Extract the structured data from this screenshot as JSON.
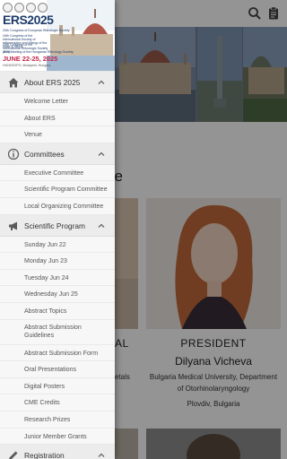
{
  "drawer": {
    "header": {
      "title": "ERS2025",
      "lines": [
        "20th Congress of European Rhinologic Society",
        "44th Congress of the International Society of Inflammation and Allergy of the Nose & ISIAN",
        "25th Congress of the International Rhinologic Society (IRS)",
        "Joint Meeting of the Hungarian Rhinology Society"
      ],
      "dates": "JUNE 22-25, 2025",
      "venue": "HUNGEXPO, Budapest, Hungary"
    },
    "sections": [
      {
        "label": "About ERS 2025",
        "icon": "home-icon",
        "expanded": true,
        "items": [
          "Welcome Letter",
          "About ERS",
          "Venue"
        ]
      },
      {
        "label": "Committees",
        "icon": "info-icon",
        "expanded": true,
        "items": [
          "Executive Committee",
          "Scientific Program Committee",
          "Local Organizing Committee"
        ]
      },
      {
        "label": "Scientific Program",
        "icon": "megaphone-icon",
        "expanded": true,
        "items": [
          "Sunday Jun 22",
          "Monday Jun 23",
          "Tuesday Jun 24",
          "Wednesday Jun 25",
          "Abstract Topics",
          "Abstract Submission Guidelines",
          "Abstract Submission Form",
          "Oral Presentations",
          "Digital Posters",
          "CME Credits",
          "Research Prizes",
          "Junior Member Grants"
        ]
      },
      {
        "label": "Registration",
        "icon": "pencil-icon",
        "expanded": true,
        "items": []
      }
    ]
  },
  "background": {
    "section_title_fragment": "ee",
    "left_role_fragment": "AL",
    "left_affil_fragment": "etals",
    "president": {
      "role": "PRESIDENT",
      "name": "Dilyana Vicheva",
      "affiliation": "Bulgaria Medical University, Department of Otorhinolaryngology",
      "city": "Plovdiv, Bulgaria"
    }
  },
  "colors": {
    "primary": "#1d3b6a",
    "accent": "#c2274a",
    "section_bg": "#ececec",
    "icon_gray": "#5a5a5a"
  }
}
